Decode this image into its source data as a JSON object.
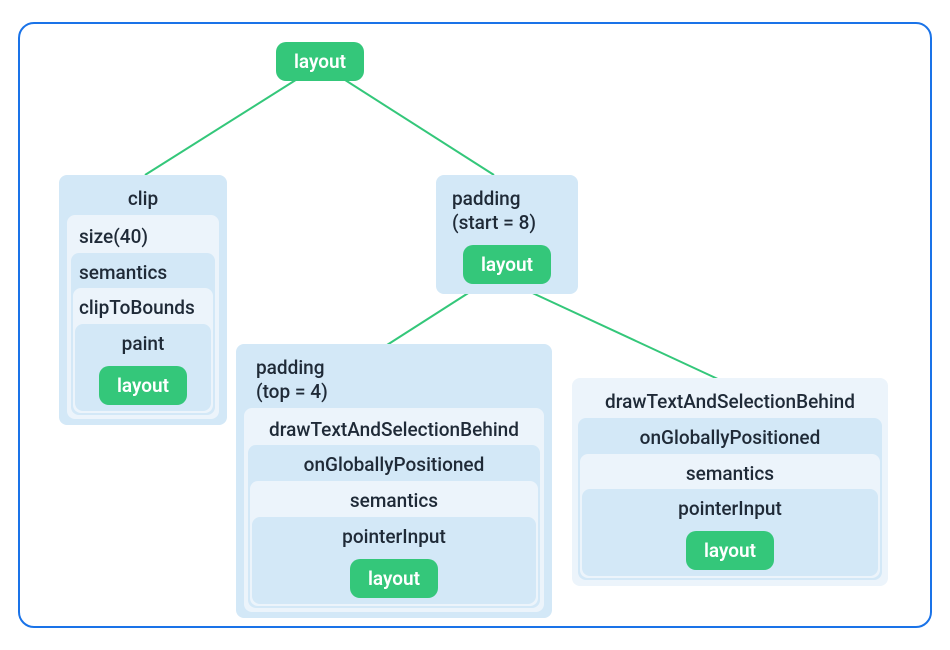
{
  "root": {
    "label": "layout"
  },
  "leftBox": {
    "l1": "clip",
    "l2": "size(40)",
    "l3": "semantics",
    "l4": "clipToBounds",
    "l5": "paint",
    "leaf": "layout"
  },
  "centerTop": {
    "line1": "padding",
    "line2": "(start = 8)",
    "leaf": "layout"
  },
  "bottomLeft": {
    "line1": "padding",
    "line2": "(top = 4)",
    "l3": "drawTextAndSelectionBehind",
    "l4": "onGloballyPositioned",
    "l5": "semantics",
    "l6": "pointerInput",
    "leaf": "layout"
  },
  "bottomRight": {
    "l3": "drawTextAndSelectionBehind",
    "l4": "onGloballyPositioned",
    "l5": "semantics",
    "l6": "pointerInput",
    "leaf": "layout"
  }
}
